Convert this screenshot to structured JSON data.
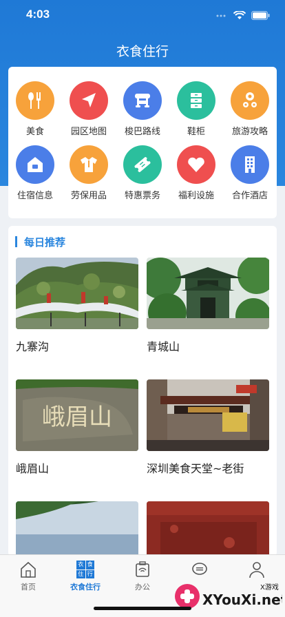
{
  "status": {
    "time": "4:03"
  },
  "nav": {
    "title": "衣食住行"
  },
  "menu": {
    "items": [
      {
        "label": "美食",
        "icon": "food-icon",
        "color": "#f7a23b"
      },
      {
        "label": "园区地图",
        "icon": "map-icon",
        "color": "#ef4f4f"
      },
      {
        "label": "梭巴路线",
        "icon": "bus-icon",
        "color": "#4b7ee8"
      },
      {
        "label": "鞋柜",
        "icon": "cabinet-icon",
        "color": "#2bbf9d"
      },
      {
        "label": "旅游攻略",
        "icon": "guide-icon",
        "color": "#f7a23b"
      },
      {
        "label": "住宿信息",
        "icon": "house-icon",
        "color": "#4b7ee8"
      },
      {
        "label": "劳保用品",
        "icon": "shirt-icon",
        "color": "#f7a23b"
      },
      {
        "label": "特惠票务",
        "icon": "ticket-icon",
        "color": "#2bbf9d"
      },
      {
        "label": "福利设施",
        "icon": "heart-icon",
        "color": "#ef4f4f"
      },
      {
        "label": "合作酒店",
        "icon": "hotel-icon",
        "color": "#4b7ee8"
      }
    ]
  },
  "recommend": {
    "title": "每日推荐",
    "spots": [
      {
        "name": "九寨沟"
      },
      {
        "name": "青城山"
      },
      {
        "name": "峨眉山",
        "carving": "峨眉山"
      },
      {
        "name": "深圳美食天堂~老街"
      },
      {
        "name": ""
      },
      {
        "name": ""
      }
    ]
  },
  "tabbar": {
    "items": [
      {
        "label": "首页",
        "icon": "home-icon"
      },
      {
        "label": "衣食住行",
        "icon": "clothing-food-icon",
        "active": true,
        "icon_text": [
          "衣",
          "食",
          "住",
          "行"
        ]
      },
      {
        "label": "办公",
        "icon": "office-icon"
      },
      {
        "label": "",
        "icon": "message-icon"
      },
      {
        "label": "",
        "icon": "profile-icon"
      }
    ]
  },
  "watermark": {
    "text": "XYouXi.net",
    "sub": "X游戏"
  }
}
